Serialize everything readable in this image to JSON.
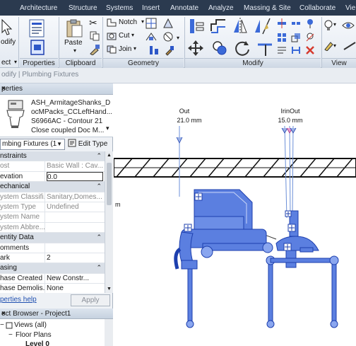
{
  "tabs": [
    "Architecture",
    "Structure",
    "Systems",
    "Insert",
    "Annotate",
    "Analyze",
    "Massing & Site",
    "Collaborate",
    "Vie"
  ],
  "ribbon": {
    "select_label": "ect",
    "modify_label": "odify",
    "properties_label": "Properties",
    "paste_label": "Paste",
    "clipboard_label": "Clipboard",
    "notch_label": "Notch",
    "cut_label": "Cut",
    "join_label": "Join",
    "geometry_label": "Geometry",
    "modify_group_label": "Modify",
    "view_label": "View"
  },
  "options_bar": {
    "context": "odify | Plumbing Fixtures"
  },
  "properties": {
    "title": "perties",
    "type_lines": [
      "ASH_ArmitageShanks_D",
      "ocMPacks_CCLeftHand...",
      "S6966AC - Contour 21",
      "Close coupled Doc M..."
    ],
    "instance_selector": "mbing Fixtures (1",
    "edit_type": "Edit Type",
    "rows": [
      {
        "kind": "section",
        "label": "nstraints"
      },
      {
        "kind": "prop",
        "label": "ost",
        "value": "Basic Wall : Cav...",
        "grey": true
      },
      {
        "kind": "prop",
        "label": "evation",
        "value": "0.0",
        "edit": true
      },
      {
        "kind": "section",
        "label": "echanical"
      },
      {
        "kind": "prop",
        "label": "ystem Classifi...",
        "value": "Sanitary,Domes...",
        "grey": true
      },
      {
        "kind": "prop",
        "label": "ystem Type",
        "value": "Undefined",
        "grey": true
      },
      {
        "kind": "prop",
        "label": "ystem Name",
        "value": "",
        "grey": true
      },
      {
        "kind": "prop",
        "label": "ystem Abbre...",
        "value": "",
        "grey": true
      },
      {
        "kind": "section",
        "label": "entity Data"
      },
      {
        "kind": "prop",
        "label": "omments",
        "value": ""
      },
      {
        "kind": "prop",
        "label": "ark",
        "value": "2"
      },
      {
        "kind": "section",
        "label": "asing"
      },
      {
        "kind": "prop",
        "label": "hase Created",
        "value": "New Constr..."
      },
      {
        "kind": "prop",
        "label": "hase Demolis...",
        "value": "None"
      }
    ],
    "help_link": "perties help",
    "apply": "Apply"
  },
  "browser": {
    "title": "ect Browser - Project1",
    "nodes": [
      "Views (all)",
      "Floor Plans",
      "Level 0"
    ]
  },
  "canvas": {
    "labels": [
      {
        "text": "Out"
      },
      {
        "text": "21.0 mm"
      },
      {
        "text": "IrinOut"
      },
      {
        "text": "15.0 mm"
      },
      {
        "text": "m"
      }
    ]
  },
  "colors": {
    "fixture_fill": "#5b7fe0",
    "fixture_stroke": "#1d3fae",
    "ribbon_tab_bg": "#2b3a4f",
    "delete_red": "#d63a2e"
  }
}
